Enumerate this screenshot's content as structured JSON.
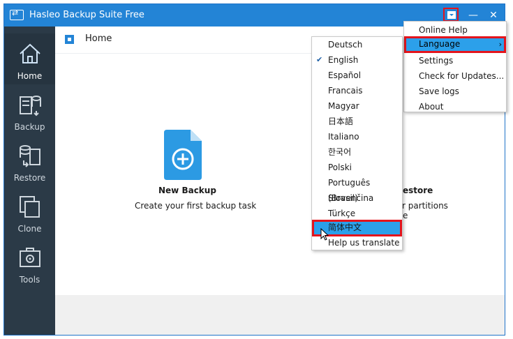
{
  "window": {
    "title": "Hasleo Backup Suite Free"
  },
  "sidebar": {
    "items": [
      {
        "label": "Home",
        "icon": "home-icon",
        "active": true
      },
      {
        "label": "Backup",
        "icon": "backup-icon"
      },
      {
        "label": "Restore",
        "icon": "restore-icon"
      },
      {
        "label": "Clone",
        "icon": "clone-icon"
      },
      {
        "label": "Tools",
        "icon": "tools-icon"
      }
    ]
  },
  "breadcrumb": {
    "label": "Home"
  },
  "main": {
    "tile1": {
      "title": "New Backup",
      "desc": "Create your first backup task"
    },
    "tile2": {
      "title_partial": "estore",
      "desc_partial1": "r partitions",
      "desc_partial2": "e"
    }
  },
  "menu": {
    "items": [
      {
        "label": "Online Help"
      },
      {
        "label": "Language",
        "submenu_arrow": "›",
        "active": true
      },
      {
        "label": "Settings"
      },
      {
        "label": "Check for Updates..."
      },
      {
        "label": "Save logs"
      },
      {
        "label": "About"
      }
    ]
  },
  "languages": {
    "items": [
      {
        "label": "Deutsch"
      },
      {
        "label": "English",
        "checked": true
      },
      {
        "label": "Español"
      },
      {
        "label": "Francais"
      },
      {
        "label": "Magyar"
      },
      {
        "label": "日本語"
      },
      {
        "label": "Italiano"
      },
      {
        "label": "한국어"
      },
      {
        "label": "Polski"
      },
      {
        "label": "Português (Brasil)"
      },
      {
        "label": "Slovenčina"
      },
      {
        "label": "Türkçe"
      },
      {
        "label": "简体中文",
        "selected": true
      },
      {
        "label": "Help us translate"
      }
    ],
    "check_mark": "✔"
  },
  "colors": {
    "titlebar": "#2384d6",
    "sidebar": "#2b3a47",
    "highlight": "#2ca0ea",
    "annotation": "#e4141c"
  }
}
